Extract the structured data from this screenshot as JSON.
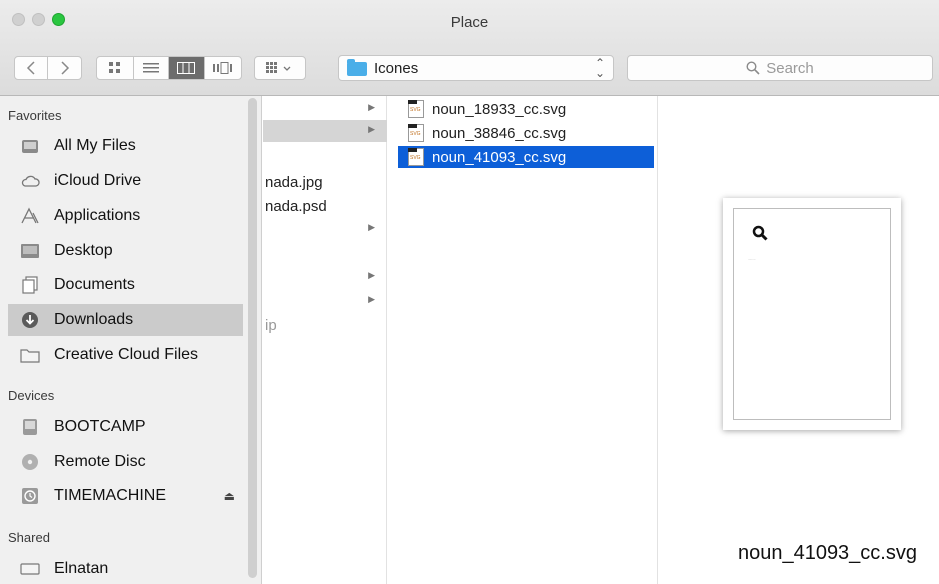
{
  "window": {
    "title": "Place"
  },
  "toolbar": {
    "path_folder": "Icones",
    "search_placeholder": "Search"
  },
  "sidebar": {
    "favorites_header": "Favorites",
    "favorites": [
      {
        "label": "All My Files",
        "icon": "all-files-icon"
      },
      {
        "label": "iCloud Drive",
        "icon": "cloud-icon"
      },
      {
        "label": "Applications",
        "icon": "applications-icon"
      },
      {
        "label": "Desktop",
        "icon": "desktop-icon"
      },
      {
        "label": "Documents",
        "icon": "documents-icon"
      },
      {
        "label": "Downloads",
        "icon": "downloads-icon",
        "selected": true
      },
      {
        "label": "Creative Cloud Files",
        "icon": "folder-icon"
      }
    ],
    "devices_header": "Devices",
    "devices": [
      {
        "label": "BOOTCAMP",
        "icon": "disk-icon"
      },
      {
        "label": "Remote Disc",
        "icon": "remote-disc-icon"
      },
      {
        "label": "TIMEMACHINE",
        "icon": "time-machine-icon",
        "eject": "⏏"
      }
    ],
    "shared_header": "Shared",
    "shared": [
      {
        "label": "Elnatan",
        "icon": "computer-icon"
      }
    ]
  },
  "column1": {
    "rows": [
      {
        "text": ""
      },
      {
        "text": ""
      },
      {
        "text": ""
      },
      {
        "text": "nada.jpg"
      },
      {
        "text": "nada.psd"
      },
      {
        "text": ""
      },
      {
        "text": ""
      },
      {
        "text": ""
      },
      {
        "text": "ip"
      },
      {
        "text": ""
      }
    ]
  },
  "column2": {
    "files": [
      {
        "name": "noun_18933_cc.svg"
      },
      {
        "name": "noun_38846_cc.svg"
      },
      {
        "name": "noun_41093_cc.svg",
        "selected": true
      }
    ]
  },
  "preview": {
    "file_name": "noun_41093_cc.svg"
  },
  "colors": {
    "selection_blue": "#0d5fd8",
    "zoom_green": "#2ac640",
    "folder_blue": "#4aaee8"
  }
}
